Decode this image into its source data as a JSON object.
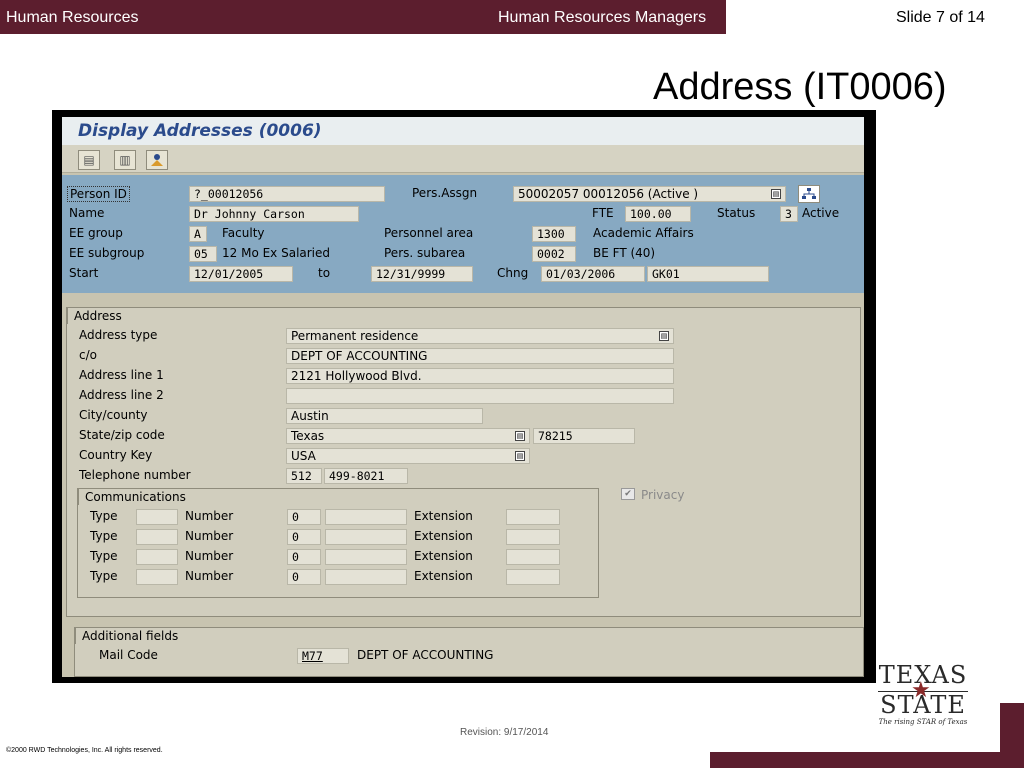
{
  "slide": {
    "header_left": "Human Resources",
    "header_center": "Human Resources Managers",
    "slide_number": "Slide 7 of 14",
    "title": "Address (IT0006)",
    "revision": "Revision: 9/17/2014",
    "copyright": "©2000 RWD Technologies, Inc.  All rights reserved.",
    "logo_line1": "TEXAS",
    "logo_line2": "STATE",
    "logo_tagline": "The rising STAR of Texas"
  },
  "sap": {
    "screen_title": "Display Addresses (0006)",
    "header": {
      "person_id_label": "Person ID",
      "person_id": "?_00012056",
      "pers_assgn_label": "Pers.Assgn",
      "pers_assgn": "50002057 00012056 (Active )",
      "name_label": "Name",
      "name": "Dr  Johnny  Carson",
      "fte_label": "FTE",
      "fte": "100.00",
      "status_label": "Status",
      "status_code": "3",
      "status_text": "Active",
      "ee_group_label": "EE group",
      "ee_group_code": "A",
      "ee_group_text": "Faculty",
      "personnel_area_label": "Personnel area",
      "personnel_area_code": "1300",
      "personnel_area_text": "Academic Affairs",
      "ee_subgroup_label": "EE subgroup",
      "ee_subgroup_code": "05",
      "ee_subgroup_text": "12 Mo Ex Salaried",
      "pers_subarea_label": "Pers. subarea",
      "pers_subarea_code": "0002",
      "pers_subarea_text": "BE FT (40)",
      "start_label": "Start",
      "start_date": "12/01/2005",
      "to_label": "to",
      "end_date": "12/31/9999",
      "chng_label": "Chng",
      "chng_date": "01/03/2006",
      "chng_user": "GK01"
    },
    "address": {
      "section_label": "Address",
      "address_type_label": "Address type",
      "address_type": "Permanent residence",
      "co_label": "c/o",
      "co": "DEPT OF ACCOUNTING",
      "line1_label": "Address line 1",
      "line1": "2121 Hollywood Blvd.",
      "line2_label": "Address line 2",
      "line2": "",
      "city_label": "City/county",
      "city": "Austin",
      "state_label": "State/zip code",
      "state": "Texas",
      "zip": "78215",
      "country_label": "Country Key",
      "country": "USA",
      "phone_label": "Telephone number",
      "phone_area": "512",
      "phone_number": "499-8021",
      "privacy_label": "Privacy",
      "communications": {
        "section_label": "Communications",
        "type_label": "Type",
        "number_label": "Number",
        "extension_label": "Extension",
        "rows": [
          {
            "type": "",
            "number": "0",
            "extension": ""
          },
          {
            "type": "",
            "number": "0",
            "extension": ""
          },
          {
            "type": "",
            "number": "0",
            "extension": ""
          },
          {
            "type": "",
            "number": "0",
            "extension": ""
          }
        ]
      }
    },
    "additional": {
      "section_label": "Additional fields",
      "mail_code_label": "Mail Code",
      "mail_code": "M77",
      "mail_code_text": "DEPT OF ACCOUNTING"
    }
  }
}
